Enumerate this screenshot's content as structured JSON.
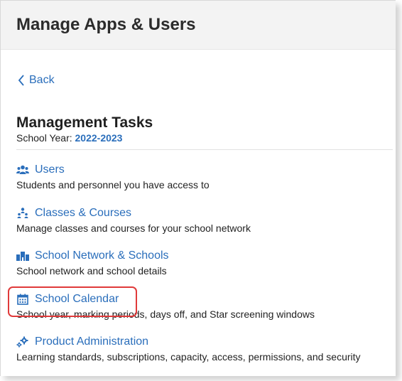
{
  "header": {
    "title": "Manage Apps & Users"
  },
  "nav": {
    "back_label": "Back"
  },
  "section": {
    "title": "Management Tasks",
    "school_year_label": "School Year:",
    "school_year_value": "2022-2023"
  },
  "tasks": [
    {
      "label": "Users",
      "icon": "users-icon",
      "description": "Students and personnel you have access to"
    },
    {
      "label": "Classes & Courses",
      "icon": "classes-icon",
      "description": "Manage classes and courses for your school network"
    },
    {
      "label": "School Network & Schools",
      "icon": "school-network-icon",
      "description": "School network and school details"
    },
    {
      "label": "School Calendar",
      "icon": "calendar-icon",
      "description": "School year, marking periods, days off, and Star screening windows"
    },
    {
      "label": "Product Administration",
      "icon": "gear-icon",
      "description": "Learning standards, subscriptions, capacity, access, permissions, and security"
    }
  ],
  "colors": {
    "link": "#2a6ebb",
    "highlight": "#e03a3a",
    "header_bg": "#f3f3f3"
  }
}
